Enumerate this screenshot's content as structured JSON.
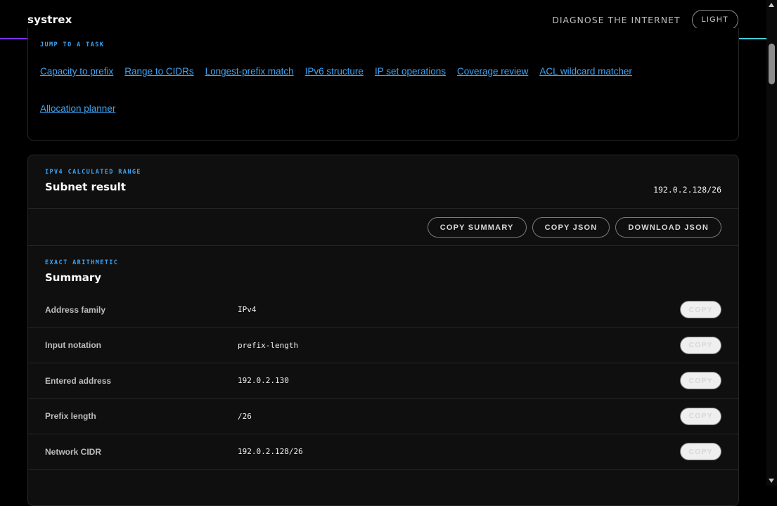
{
  "header": {
    "brand": "systrex",
    "nav_link": "DIAGNOSE THE INTERNET",
    "theme_toggle": "LIGHT"
  },
  "jump": {
    "eyebrow": "JUMP TO A TASK",
    "links": [
      "Capacity to prefix",
      "Range to CIDRs",
      "Longest-prefix match",
      "IPv6 structure",
      "IP set operations",
      "Coverage review",
      "ACL wildcard matcher",
      "Allocation planner"
    ]
  },
  "result": {
    "eyebrow": "IPV4 CALCULATED RANGE",
    "title": "Subnet result",
    "cidr": "192.0.2.128/26",
    "actions": [
      "COPY SUMMARY",
      "COPY JSON",
      "DOWNLOAD JSON"
    ]
  },
  "summary": {
    "eyebrow": "EXACT ARITHMETIC",
    "title": "Summary",
    "copy_label": "COPY",
    "rows": [
      {
        "label": "Address family",
        "value": "IPv4"
      },
      {
        "label": "Input notation",
        "value": "prefix-length"
      },
      {
        "label": "Entered address",
        "value": "192.0.2.130"
      },
      {
        "label": "Prefix length",
        "value": "/26"
      },
      {
        "label": "Network CIDR",
        "value": "192.0.2.128/26"
      }
    ]
  },
  "colors": {
    "accent": "#3ea4f5",
    "background": "#000000",
    "panel": "#0f0f0f",
    "gradient_start": "#7a2ff0",
    "gradient_end": "#3fd0d8"
  }
}
